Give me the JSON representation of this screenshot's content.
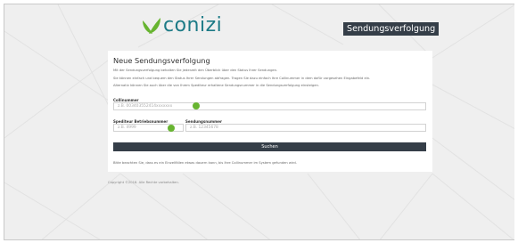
{
  "header": {
    "logo_text": "conizi",
    "title": "Sendungsverfolgung"
  },
  "form": {
    "heading": "Neue Sendungsverfolgung",
    "description": [
      "Mit der Sendungsverfolgung behalten Sie jederzeit den Überblick über den Status Ihrer Sendungen.",
      "Sie können einfach und bequem den Status Ihrer Sendungen abfragen. Tragen Sie dazu einfach Ihre Collinummer in dem dafür vorgesehen Eingabefeld ein.",
      "Alternativ können Sie auch über die von Ihrem Spediteur erhaltene Sendungsnummer in die Sendungsverfolgung einsteigen."
    ],
    "collinummer": {
      "label": "Collinummer",
      "placeholder": "z.B. 003403552414xxxxxxx"
    },
    "betriebsnummer": {
      "label": "Spediteur Betriebsnummer",
      "placeholder": "z.B. 4999"
    },
    "sendungsnummer": {
      "label": "Sendungsnummer",
      "placeholder": "z.B. 12345678"
    },
    "submit_label": "Suchen",
    "note": "Bitte beachten Sie, dass es ein Einzelfällen etwas dauern kann, bis Ihre Collinummer im System gefunden wird."
  },
  "footer": {
    "copyright": "Copyright ©2018. Alle Rechte vorbehalten."
  },
  "colors": {
    "brand_teal": "#1c7a86",
    "brand_green": "#67b430",
    "dark": "#353e48"
  }
}
